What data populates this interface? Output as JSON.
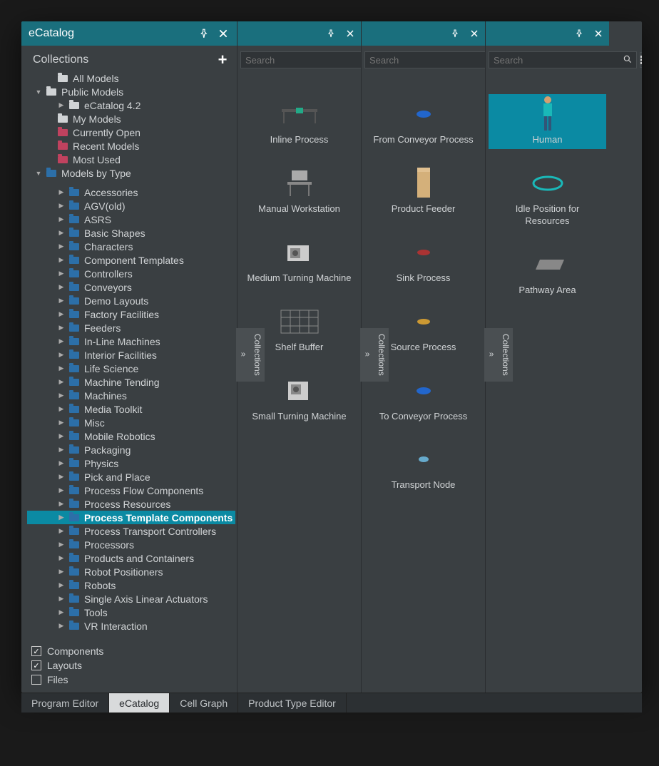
{
  "titlebar": {
    "title": "eCatalog"
  },
  "sidebar": {
    "header": "Collections",
    "tree": [
      {
        "label": "All Models",
        "indent": 1,
        "caret": "",
        "icon": "dark"
      },
      {
        "label": "Public Models",
        "indent": 0,
        "caret": "▼",
        "icon": "dark"
      },
      {
        "label": "eCatalog 4.2",
        "indent": 2,
        "caret": "▶",
        "icon": "dark"
      },
      {
        "label": "My Models",
        "indent": 1,
        "caret": "",
        "icon": "dark"
      },
      {
        "label": "Currently Open",
        "indent": 1,
        "caret": "",
        "icon": "pink"
      },
      {
        "label": "Recent Models",
        "indent": 1,
        "caret": "",
        "icon": "pink"
      },
      {
        "label": "Most Used",
        "indent": 1,
        "caret": "",
        "icon": "pink"
      },
      {
        "label": "Models by Type",
        "indent": 0,
        "caret": "▼",
        "icon": "blue"
      },
      {
        "label": "",
        "indent": 0,
        "caret": "",
        "icon": ""
      },
      {
        "label": "Accessories",
        "indent": 2,
        "caret": "▶",
        "icon": "blue"
      },
      {
        "label": "AGV(old)",
        "indent": 2,
        "caret": "▶",
        "icon": "blue"
      },
      {
        "label": "ASRS",
        "indent": 2,
        "caret": "▶",
        "icon": "blue"
      },
      {
        "label": "Basic Shapes",
        "indent": 2,
        "caret": "▶",
        "icon": "blue"
      },
      {
        "label": "Characters",
        "indent": 2,
        "caret": "▶",
        "icon": "blue"
      },
      {
        "label": "Component Templates",
        "indent": 2,
        "caret": "▶",
        "icon": "blue"
      },
      {
        "label": "Controllers",
        "indent": 2,
        "caret": "▶",
        "icon": "blue"
      },
      {
        "label": "Conveyors",
        "indent": 2,
        "caret": "▶",
        "icon": "blue"
      },
      {
        "label": "Demo Layouts",
        "indent": 2,
        "caret": "▶",
        "icon": "blue"
      },
      {
        "label": "Factory Facilities",
        "indent": 2,
        "caret": "▶",
        "icon": "blue"
      },
      {
        "label": "Feeders",
        "indent": 2,
        "caret": "▶",
        "icon": "blue"
      },
      {
        "label": "In-Line Machines",
        "indent": 2,
        "caret": "▶",
        "icon": "blue"
      },
      {
        "label": "Interior Facilities",
        "indent": 2,
        "caret": "▶",
        "icon": "blue"
      },
      {
        "label": "Life Science",
        "indent": 2,
        "caret": "▶",
        "icon": "blue"
      },
      {
        "label": "Machine Tending",
        "indent": 2,
        "caret": "▶",
        "icon": "blue"
      },
      {
        "label": "Machines",
        "indent": 2,
        "caret": "▶",
        "icon": "blue"
      },
      {
        "label": "Media Toolkit",
        "indent": 2,
        "caret": "▶",
        "icon": "blue"
      },
      {
        "label": "Misc",
        "indent": 2,
        "caret": "▶",
        "icon": "blue"
      },
      {
        "label": "Mobile Robotics",
        "indent": 2,
        "caret": "▶",
        "icon": "blue"
      },
      {
        "label": "Packaging",
        "indent": 2,
        "caret": "▶",
        "icon": "blue"
      },
      {
        "label": "Physics",
        "indent": 2,
        "caret": "▶",
        "icon": "blue"
      },
      {
        "label": "Pick and Place",
        "indent": 2,
        "caret": "▶",
        "icon": "blue"
      },
      {
        "label": "Process Flow Components",
        "indent": 2,
        "caret": "▶",
        "icon": "blue"
      },
      {
        "label": "Process Resources",
        "indent": 2,
        "caret": "▶",
        "icon": "blue"
      },
      {
        "label": "Process Template Components",
        "indent": 2,
        "caret": "▶",
        "icon": "blue",
        "selected": true
      },
      {
        "label": "Process Transport Controllers",
        "indent": 2,
        "caret": "▶",
        "icon": "blue"
      },
      {
        "label": "Processors",
        "indent": 2,
        "caret": "▶",
        "icon": "blue"
      },
      {
        "label": "Products and Containers",
        "indent": 2,
        "caret": "▶",
        "icon": "blue"
      },
      {
        "label": "Robot Positioners",
        "indent": 2,
        "caret": "▶",
        "icon": "blue"
      },
      {
        "label": "Robots",
        "indent": 2,
        "caret": "▶",
        "icon": "blue"
      },
      {
        "label": "Single Axis Linear Actuators",
        "indent": 2,
        "caret": "▶",
        "icon": "blue"
      },
      {
        "label": "Tools",
        "indent": 2,
        "caret": "▶",
        "icon": "blue"
      },
      {
        "label": "VR Interaction",
        "indent": 2,
        "caret": "▶",
        "icon": "blue"
      }
    ],
    "filters": [
      {
        "label": "Components",
        "checked": true
      },
      {
        "label": "Layouts",
        "checked": true
      },
      {
        "label": "Files",
        "checked": false
      }
    ]
  },
  "search": {
    "placeholder": "Search"
  },
  "gallery1": [
    {
      "label": "Inline Process"
    },
    {
      "label": "Manual Workstation"
    },
    {
      "label": "Medium Turning Machine"
    },
    {
      "label": "Shelf Buffer"
    },
    {
      "label": "Small Turning Machine"
    }
  ],
  "gallery2": [
    {
      "label": "From Conveyor Process"
    },
    {
      "label": "Product Feeder"
    },
    {
      "label": "Sink Process"
    },
    {
      "label": "Source Process"
    },
    {
      "label": "To Conveyor Process"
    },
    {
      "label": "Transport Node"
    }
  ],
  "gallery3": [
    {
      "label": "Human",
      "selected": true
    },
    {
      "label": "Idle Position for Resources"
    },
    {
      "label": "Pathway Area"
    }
  ],
  "sideTab": {
    "label": "Collections"
  },
  "bottomTabs": [
    {
      "label": "Program Editor",
      "active": false
    },
    {
      "label": "eCatalog",
      "active": true
    },
    {
      "label": "Cell Graph",
      "active": false
    },
    {
      "label": "Product Type Editor",
      "active": false
    }
  ]
}
